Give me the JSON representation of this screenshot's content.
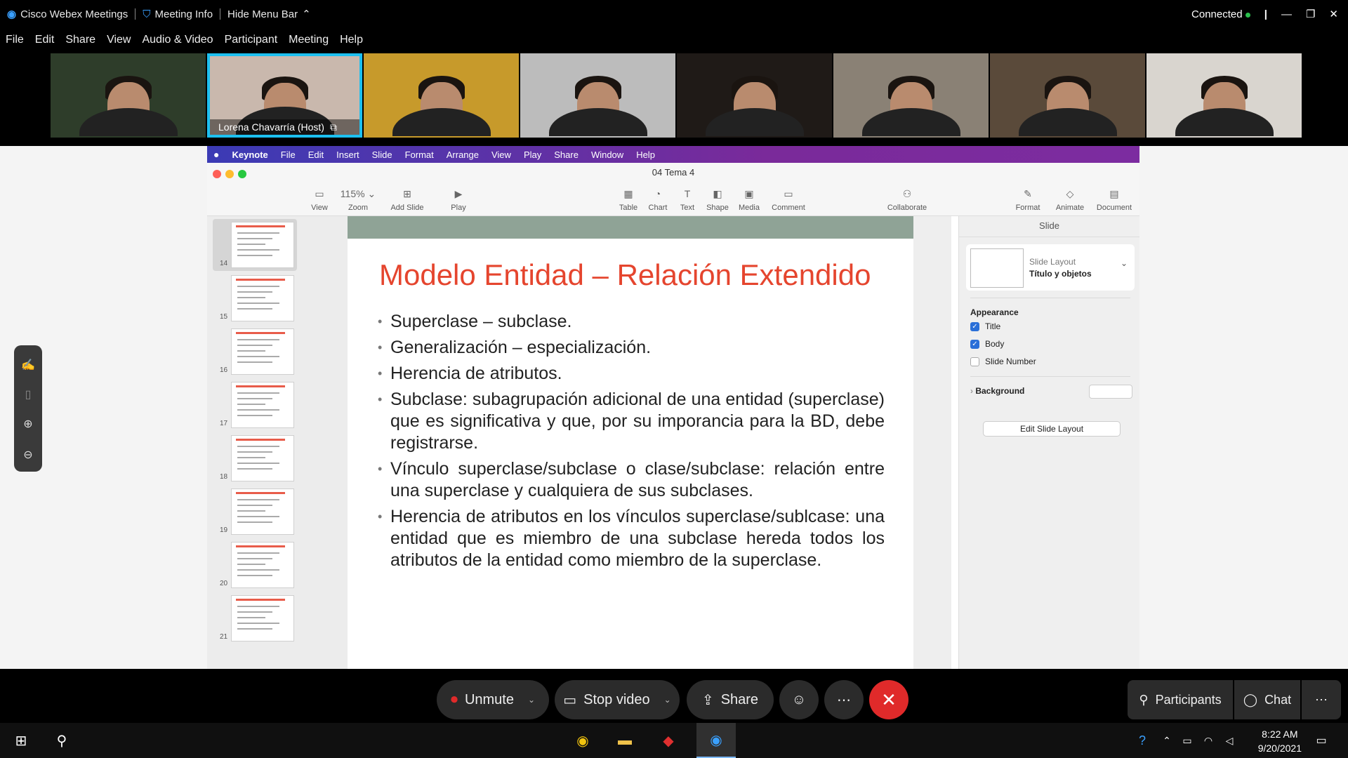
{
  "webex": {
    "app_title": "Cisco Webex Meetings",
    "meeting_info": "Meeting Info",
    "hide_menu_bar": "Hide Menu Bar",
    "status": "Connected",
    "menu": [
      "File",
      "Edit",
      "Share",
      "View",
      "Audio & Video",
      "Participant",
      "Meeting",
      "Help"
    ]
  },
  "participants": [
    {
      "name": "",
      "bg": "#2e3d2a",
      "active": false
    },
    {
      "name": "Lorena Chavarría  (Host)",
      "bg": "#c9b8ad",
      "active": true
    },
    {
      "name": "",
      "bg": "#c79a2b",
      "active": false
    },
    {
      "name": "",
      "bg": "#bcbcbc",
      "active": false
    },
    {
      "name": "",
      "bg": "#1f1a17",
      "active": false
    },
    {
      "name": "",
      "bg": "#8a8175",
      "active": false
    },
    {
      "name": "",
      "bg": "#5a4a3a",
      "active": false
    },
    {
      "name": "",
      "bg": "#d9d5cf",
      "active": false
    }
  ],
  "mac_menu": [
    "Keynote",
    "File",
    "Edit",
    "Insert",
    "Slide",
    "Format",
    "Arrange",
    "View",
    "Play",
    "Share",
    "Window",
    "Help"
  ],
  "keynote": {
    "doc_title": "04 Tema 4",
    "zoom": "115%",
    "toolbar": {
      "view": "View",
      "zoom": "Zoom",
      "add_slide": "Add Slide",
      "play": "Play",
      "table": "Table",
      "chart": "Chart",
      "text": "Text",
      "shape": "Shape",
      "media": "Media",
      "comment": "Comment",
      "collaborate": "Collaborate",
      "format": "Format",
      "animate": "Animate",
      "document": "Document"
    },
    "thumbnails": [
      "14",
      "15",
      "16",
      "17",
      "18",
      "19",
      "20",
      "21"
    ],
    "slide": {
      "title": "Modelo Entidad – Relación Extendido",
      "bullets": [
        "Superclase – subclase.",
        "Generalización – especialización.",
        "Herencia de atributos.",
        "Subclase: subagrupación adicional de una entidad (superclase) que es significativa y que, por su imporancia para la BD, debe registrarse.",
        "Vínculo superclase/subclase o clase/subclase: relación entre una superclase y cualquiera de sus subclases.",
        "Herencia de atributos en los vínculos superclase/sublcase: una entidad que es miembro de una subclase hereda todos los atributos de la entidad como miembro de la superclase."
      ]
    },
    "inspector": {
      "heading": "Slide",
      "layout_label": "Slide Layout",
      "layout_value": "Título y objetos",
      "appearance": "Appearance",
      "title_cb": "Title",
      "body_cb": "Body",
      "slide_number_cb": "Slide Number",
      "background": "Background",
      "edit_layout": "Edit Slide Layout"
    }
  },
  "controls": {
    "unmute": "Unmute",
    "stop_video": "Stop video",
    "share": "Share",
    "participants": "Participants",
    "chat": "Chat"
  },
  "taskbar": {
    "time": "8:22 AM",
    "date": "9/20/2021"
  }
}
